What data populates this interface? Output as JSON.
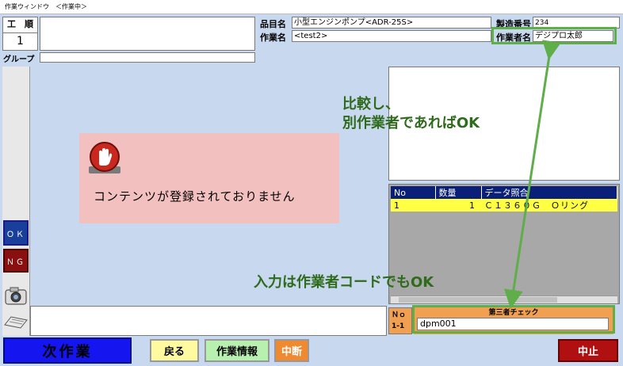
{
  "window": {
    "title": "作業ウィンドウ　＜作業中＞"
  },
  "process": {
    "label": "工　順",
    "value": "1"
  },
  "group": {
    "label": "グループ",
    "value": ""
  },
  "header": {
    "product_name_label": "品目名",
    "product_name_value": "小型エンジンポンプ<ADR-25S>",
    "work_name_label": "作業名",
    "work_name_value": "<test2>",
    "serial_label": "製造番号",
    "serial_value": "234",
    "worker_label": "作業者名",
    "worker_value": "デジプロ太郎"
  },
  "content": {
    "message": "コンテンツが登録されておりません"
  },
  "sidebar": {
    "ok_label": "ＯＫ",
    "ng_label": "ＮＧ"
  },
  "data_table": {
    "columns": [
      "No",
      "数量",
      "データ照合"
    ],
    "rows": [
      {
        "no": "1",
        "qty": "1",
        "data": "Ｃ１３６０Ｇ　Ｏリング"
      }
    ]
  },
  "check": {
    "no_label": "Ｎｏ",
    "no_value": "1-1",
    "title": "第三者チェック",
    "input_value": "dpm001"
  },
  "buttons": {
    "next": "次作業",
    "back": "戻る",
    "work_info": "作業情報",
    "interrupt": "中断",
    "stop": "中止"
  },
  "annotations": {
    "compare_line1": "比較し、",
    "compare_line2": "別作業者であればOK",
    "input_note": "入力は作業者コードでもOK"
  },
  "colors": {
    "background": "#c8d8ee",
    "highlight_green": "#5fae4a",
    "annotation_text": "#2e6b1c",
    "next_button": "#1515f0",
    "stop_button": "#b01010",
    "interrupt_button": "#f08a30",
    "table_header": "#0a1f78",
    "table_row": "#ffff44",
    "message_panel": "#f3c0c0"
  }
}
